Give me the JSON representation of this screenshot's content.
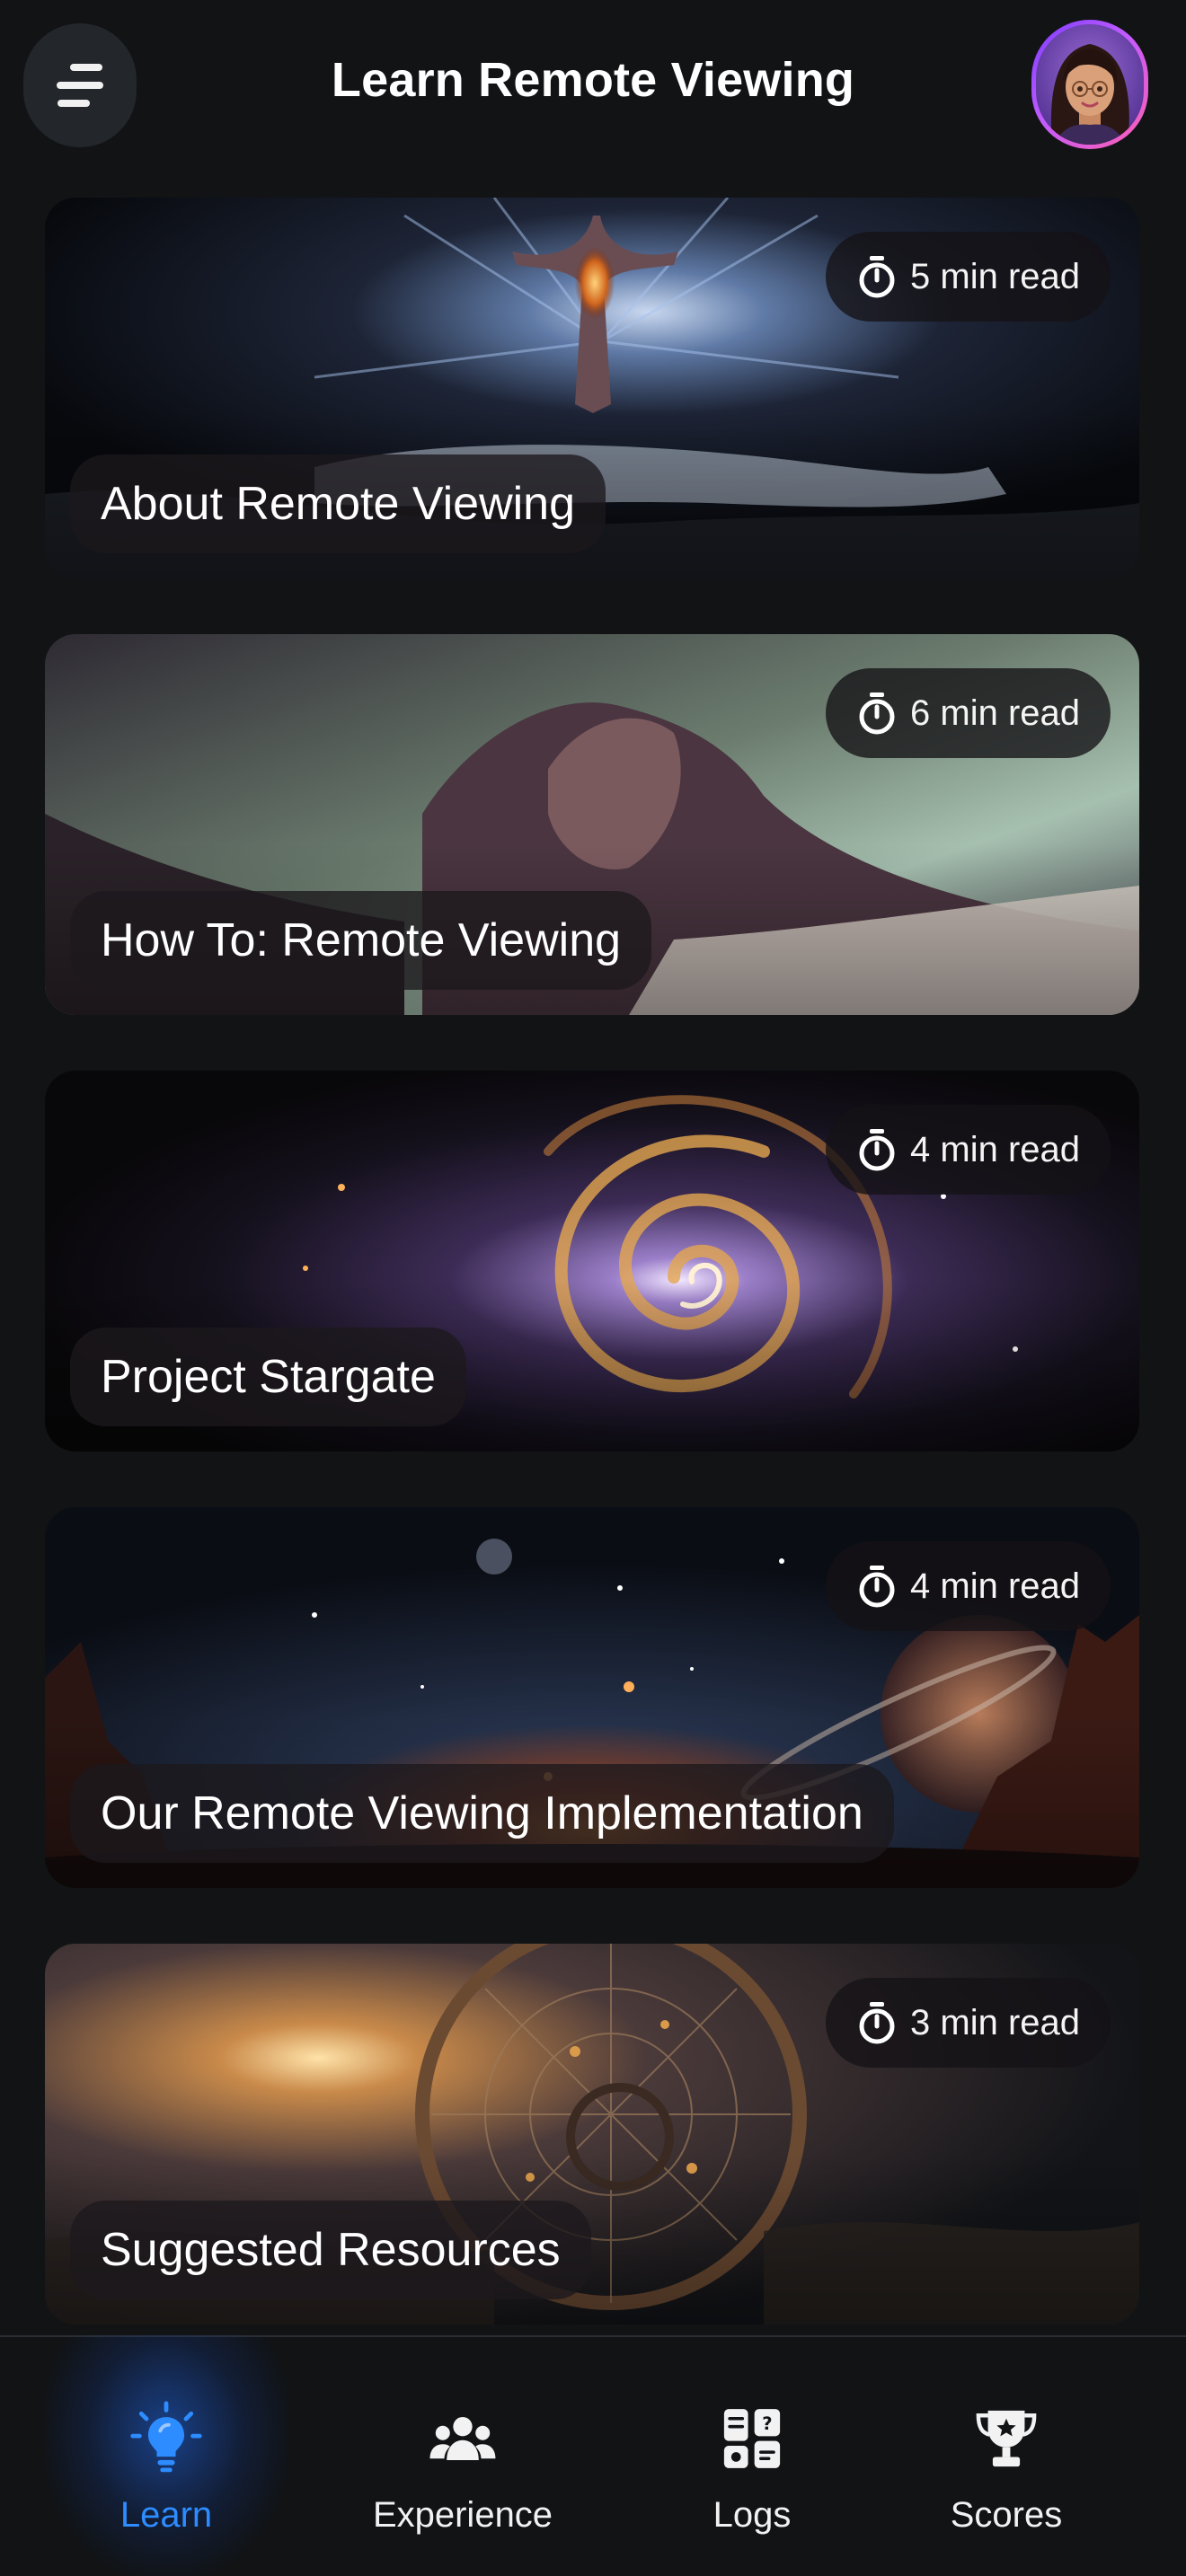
{
  "header": {
    "title": "Learn Remote Viewing",
    "menu_icon": "menu-icon",
    "avatar": "user-avatar"
  },
  "cards": [
    {
      "title": "About Remote Viewing",
      "read_time": "5 min read"
    },
    {
      "title": "How To: Remote Viewing",
      "read_time": "6 min read"
    },
    {
      "title": "Project Stargate",
      "read_time": "4 min read"
    },
    {
      "title": "Our Remote Viewing Implementation",
      "read_time": "4 min read"
    },
    {
      "title": "Suggested Resources",
      "read_time": "3 min read"
    }
  ],
  "bottom_nav": [
    {
      "label": "Learn",
      "icon": "lightbulb-icon",
      "active": true
    },
    {
      "label": "Experience",
      "icon": "people-group-icon",
      "active": false
    },
    {
      "label": "Logs",
      "icon": "logs-icon",
      "active": false
    },
    {
      "label": "Scores",
      "icon": "trophy-icon",
      "active": false
    }
  ],
  "colors": {
    "background": "#111315",
    "accent": "#2d8cff",
    "pill_background": "#1c181c"
  }
}
